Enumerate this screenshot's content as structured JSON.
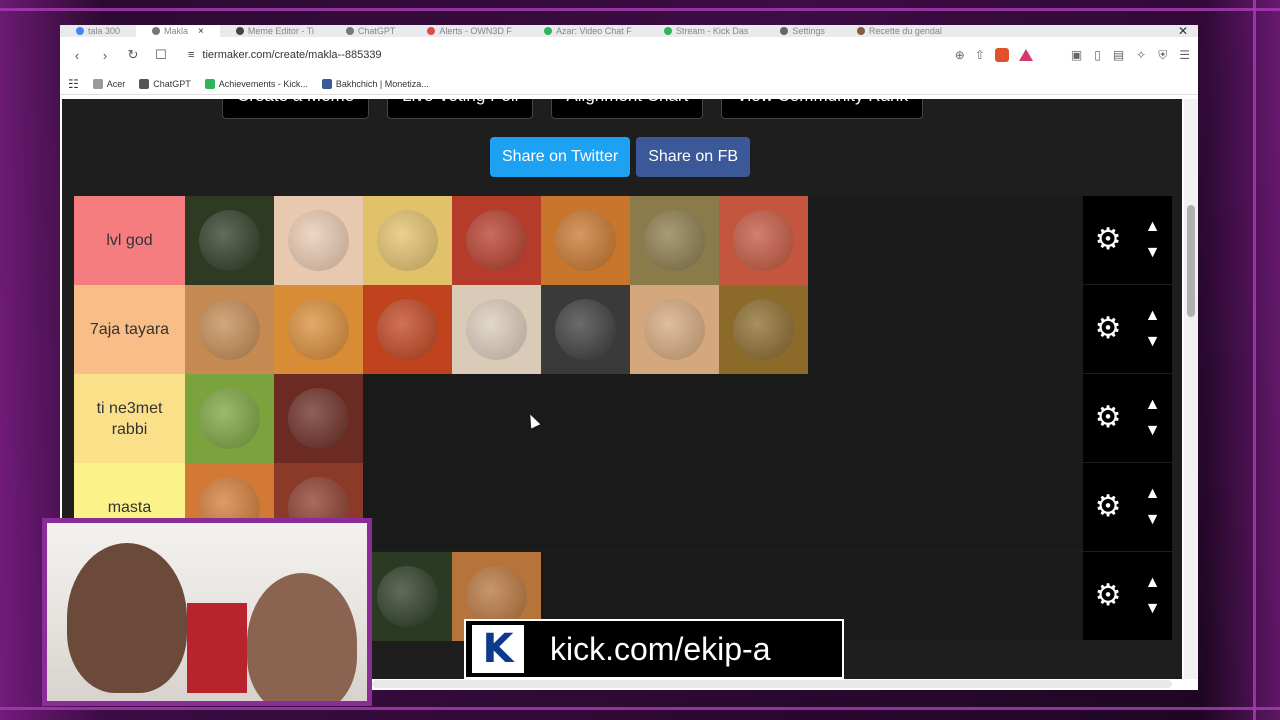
{
  "browser": {
    "tabs": [
      {
        "label": "tala 300",
        "color": "#4285f4"
      },
      {
        "label": "Makla",
        "color": "#777777",
        "active": true
      },
      {
        "label": "Meme Editor - Ti",
        "color": "#444444"
      },
      {
        "label": "ChatGPT",
        "color": "#777777"
      },
      {
        "label": "Alerts - OWN3D F",
        "color": "#e34b4b"
      },
      {
        "label": "Azar: Video Chat F",
        "color": "#2fb45a"
      },
      {
        "label": "Stream - Kick Das",
        "color": "#2fb45a"
      },
      {
        "label": "Settings",
        "color": "#666666"
      },
      {
        "label": "Recette du gendal",
        "color": "#8a5a3c"
      }
    ],
    "url": "tiermaker.com/create/makla--885339",
    "bookmarks": [
      {
        "label": "Acer",
        "color": "#999999"
      },
      {
        "label": "ChatGPT",
        "color": "#555555"
      },
      {
        "label": "Achievements - Kick...",
        "color": "#2fb45a"
      },
      {
        "label": "Bakhchich | Monetiza...",
        "color": "#3b5998"
      }
    ]
  },
  "page": {
    "top_buttons": [
      "Create a Meme",
      "Live Voting Poll",
      "Alignment Chart",
      "View Community Rank"
    ],
    "share_twitter": "Share on Twitter",
    "share_fb": "Share on FB",
    "tiers": [
      {
        "label": "lvl god",
        "color": "#f57d80",
        "items": [
          "#2f3a23",
          "#e8c9b0",
          "#e2c16b",
          "#b53b2a",
          "#c7762c",
          "#8b7a4a",
          "#c4553e"
        ]
      },
      {
        "label": "7aja tayara",
        "color": "#f9bd87",
        "items": [
          "#c48a52",
          "#d88c36",
          "#c0431e",
          "#d9cbb8",
          "#3a3a3a",
          "#d4a87c",
          "#8b6a2a"
        ]
      },
      {
        "label": "ti ne3met rabbi",
        "color": "#fbe08a",
        "items": [
          "#7aa33e",
          "#6b2a22"
        ]
      },
      {
        "label": "masta",
        "color": "#fbf38a",
        "items": [
          "#d27a35",
          "#8b3a2a"
        ]
      },
      {
        "label": "",
        "color": "#1e1e1e",
        "items": [
          "#1e1e1e",
          "#1e1e1e",
          "#2b3a23",
          "#b6733a"
        ]
      }
    ]
  },
  "overlay": {
    "kick_url": "kick.com/ekip-a",
    "kick_logo": "K"
  }
}
